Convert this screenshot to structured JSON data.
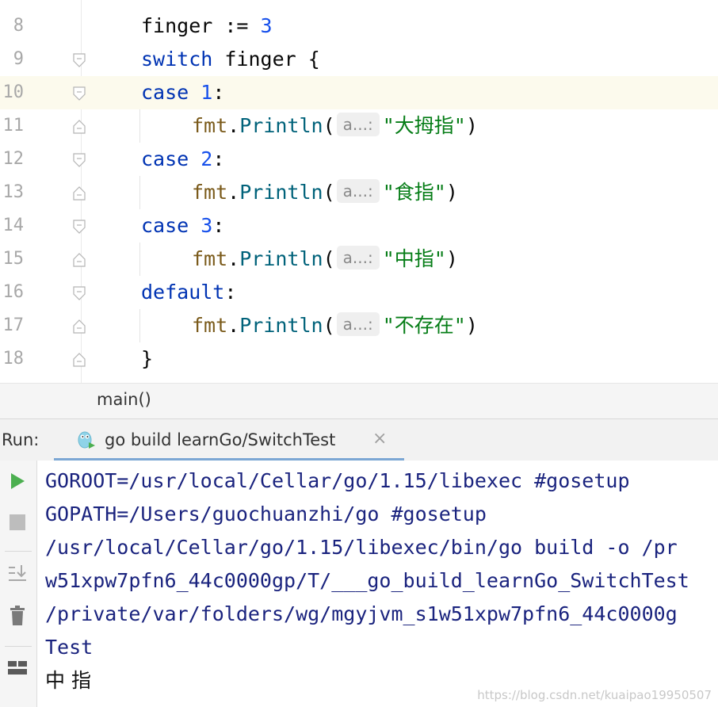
{
  "editor": {
    "lines": [
      {
        "num": "8"
      },
      {
        "num": "9"
      },
      {
        "num": "10"
      },
      {
        "num": "11"
      },
      {
        "num": "12"
      },
      {
        "num": "13"
      },
      {
        "num": "14"
      },
      {
        "num": "15"
      },
      {
        "num": "16"
      },
      {
        "num": "17"
      },
      {
        "num": "18"
      }
    ],
    "code": {
      "l8_var": "finger",
      "l8_op": ":=",
      "l8_val": "3",
      "l9_kw": "switch",
      "l9_rest": "finger {",
      "case_kw": "case",
      "case1": "1",
      "case2": "2",
      "case3": "3",
      "default_kw": "default",
      "colon": ":",
      "fmt": "fmt",
      "dot": ".",
      "println": "Println",
      "paren_open": "(",
      "paren_close": ")",
      "param_hint": "a...:",
      "str1": "\"大拇指\"",
      "str2": "\"食指\"",
      "str3": "\"中指\"",
      "str4": "\"不存在\"",
      "close_brace": "}"
    }
  },
  "breadcrumb": {
    "label": "main()"
  },
  "run": {
    "label": "Run:",
    "tab_title": "go build learnGo/SwitchTest",
    "close_glyph": "×"
  },
  "console": {
    "lines": [
      "GOROOT=/usr/local/Cellar/go/1.15/libexec #gosetup",
      "GOPATH=/Users/guochuanzhi/go #gosetup",
      "/usr/local/Cellar/go/1.15/libexec/bin/go build -o /pr",
      "w51xpw7pfn6_44c0000gp/T/___go_build_learnGo_SwitchTest",
      "/private/var/folders/wg/mgyjvm_s1w51xpw7pfn6_44c0000g",
      "Test"
    ],
    "output": "中 指"
  },
  "watermark": "https://blog.csdn.net/kuaipao19950507",
  "colors": {
    "keyword": "#0033b3",
    "number": "#1750eb",
    "string": "#067d17",
    "function": "#00627a",
    "package": "#7a5a1a",
    "console_text": "#1a237e",
    "run_green": "#4caf50",
    "current_line": "#fcfaed"
  }
}
